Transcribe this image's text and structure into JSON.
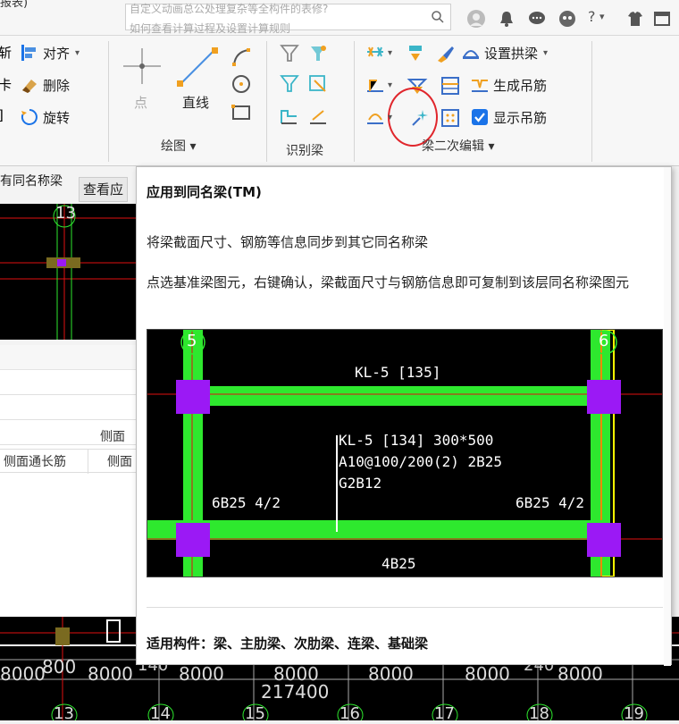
{
  "top": {
    "left_text": "报表)",
    "search_placeholder_line1": "自定义动画总公处理复杂等全构件的表修?",
    "search_placeholder_line2": "如何查看计算过程及设置计算规则",
    "icons": [
      "user-icon",
      "bell-icon",
      "chat-icon",
      "mascot-icon",
      "help-icon",
      "shirt-icon",
      "window-icon"
    ],
    "help_label": "?",
    "help_caret": "▾"
  },
  "ribbon": {
    "edit_group": {
      "align_label": "对齐",
      "delete_label": "删除",
      "rotate_label": "旋转",
      "left_cut_1": "斩",
      "left_cut_2": "卡",
      "left_cut_3": "]"
    },
    "draw_group": {
      "point_label": "点",
      "line_label": "直线",
      "group_label": "绘图 ▾"
    },
    "identify_group": {
      "group_label": "识别梁"
    },
    "beam_group": {
      "set_arch_label": "设置拱梁",
      "generate_hanger_label": "生成吊筋",
      "show_hanger_label": "显示吊筋",
      "group_label": "梁二次编辑 ▾"
    }
  },
  "left_panel": {
    "tab1": "有同名称梁",
    "tab2": "查看应",
    "axis_13": "13",
    "col_header": "侧面",
    "col1": "侧面通长筋",
    "col2": "侧面"
  },
  "tooltip": {
    "title": "应用到同名梁(TM)",
    "description": "将梁截面尺寸、钢筋等信息同步到其它同名称梁",
    "detail": "点选基准梁图元，右键确认，梁截面尺寸与钢筋信息即可复制到该层同名称梁图元",
    "applicable": "适用构件：梁、主肋梁、次肋梁、连梁、基础梁",
    "image": {
      "axis_left": "5",
      "axis_right": "6",
      "beam_top": "KL-5 [135]",
      "beam_info_1": "KL-5 [134] 300*500",
      "beam_info_2": "A10@100/200(2) 2B25",
      "beam_info_3": "G2B12",
      "left_support": "6B25 4/2",
      "right_support": "6B25 4/2",
      "bottom_rebar": "4B25"
    }
  },
  "bottom_cad": {
    "dims": [
      "8000",
      "800",
      "8000",
      "140",
      "8000",
      "8000",
      "8000",
      "8000",
      "240",
      "8000"
    ],
    "total": "217400",
    "axes": [
      "13",
      "14",
      "15",
      "16",
      "17",
      "18",
      "19"
    ]
  },
  "colors": {
    "beam_green": "#2ee82e",
    "column_purple": "#9b19f5",
    "axis_red": "#e01010",
    "highlight_red": "#e0262c",
    "accent_blue": "#1a73e8"
  }
}
